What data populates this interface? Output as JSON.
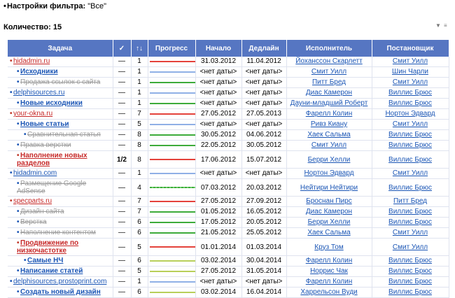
{
  "filter": {
    "label": "Настройки фильтра:",
    "value": "\"Все\""
  },
  "count": {
    "text": "Количество: 15"
  },
  "columns": [
    "Задача",
    "✓",
    "↑↓",
    "Прогресс",
    "Начало",
    "Дедлайн",
    "Исполнитель",
    "Постановщик"
  ],
  "colors": {
    "header": "#5676c2",
    "link": "#1a55b5",
    "accent_red": "#c62828"
  },
  "rows": [
    {
      "indent": 0,
      "task": "hidadmin.ru",
      "style": "red",
      "bullet": "red",
      "done": "—",
      "prio": "1",
      "progress": "red",
      "start": "31.03.2012",
      "deadline": "11.04.2012",
      "assignee": "Йоханссон Скарлетт",
      "author": "Смит Уилл"
    },
    {
      "indent": 1,
      "task": "Исходники",
      "style": "blue-bold",
      "bullet": "blue",
      "done": "—",
      "prio": "1",
      "progress": "blue",
      "start": "<нет даты>",
      "deadline": "<нет даты>",
      "assignee": "Смит Уилл",
      "author": "Шин Чарли"
    },
    {
      "indent": 1,
      "task": "Продажа ссылок с сайта",
      "style": "strike",
      "bullet": "blue",
      "done": "—",
      "prio": "1",
      "progress": "green",
      "start": "<нет даты>",
      "deadline": "<нет даты>",
      "assignee": "Питт Бред",
      "author": "Смит Уилл"
    },
    {
      "indent": 0,
      "task": "delphisources.ru",
      "style": "blue",
      "bullet": "blue",
      "done": "—",
      "prio": "1",
      "progress": "blue",
      "start": "<нет даты>",
      "deadline": "<нет даты>",
      "assignee": "Диас Камерон",
      "author": "Виллис Брюс"
    },
    {
      "indent": 1,
      "task": "Новые исходники",
      "style": "blue-bold",
      "bullet": "blue",
      "done": "—",
      "prio": "1",
      "progress": "green",
      "start": "<нет даты>",
      "deadline": "<нет даты>",
      "assignee": "Дауни-младший Роберт",
      "author": "Виллис Брюс"
    },
    {
      "indent": 0,
      "task": "your-okna.ru",
      "style": "red",
      "bullet": "red",
      "done": "—",
      "prio": "7",
      "progress": "red",
      "start": "27.05.2012",
      "deadline": "27.05.2013",
      "assignee": "Фарелл Колин",
      "author": "Нортон Эдвард"
    },
    {
      "indent": 1,
      "task": "Новые статьи",
      "style": "blue-bold",
      "bullet": "blue",
      "done": "—",
      "prio": "5",
      "progress": "blue",
      "start": "<нет даты>",
      "deadline": "<нет даты>",
      "assignee": "Ривз Киану",
      "author": "Смит Уилл"
    },
    {
      "indent": 2,
      "task": "Сравнительная статья",
      "style": "strike",
      "bullet": "blue",
      "done": "—",
      "prio": "8",
      "progress": "green",
      "start": "30.05.2012",
      "deadline": "04.06.2012",
      "assignee": "Хаек Сальма",
      "author": "Виллис Брюс"
    },
    {
      "indent": 1,
      "task": "Правка верстки",
      "style": "strike",
      "bullet": "blue",
      "done": "—",
      "prio": "8",
      "progress": "green",
      "start": "22.05.2012",
      "deadline": "30.05.2012",
      "assignee": "Смит Уилл",
      "author": "Виллис Брюс"
    },
    {
      "indent": 1,
      "task": "Наполнение новых разделов",
      "style": "red-bold",
      "bullet": "red",
      "done": "1/2",
      "prio": "8",
      "progress": "red",
      "start": "17.06.2012",
      "deadline": "15.07.2012",
      "assignee": "Берри Хелли",
      "author": "Виллис Брюс",
      "tall": true
    },
    {
      "indent": 0,
      "task": "hidadmin.com",
      "style": "blue",
      "bullet": "blue",
      "done": "—",
      "prio": "1",
      "progress": "blue",
      "start": "<нет даты>",
      "deadline": "<нет даты>",
      "assignee": "Нортон Эдвард",
      "author": "Смит Уилл"
    },
    {
      "indent": 1,
      "task": "Размещение Google AdSense",
      "style": "strike",
      "bullet": "blue",
      "done": "—",
      "prio": "4",
      "progress": "greenwave",
      "start": "07.03.2012",
      "deadline": "20.03.2012",
      "assignee": "Нейтири Нейтири",
      "author": "Виллис Брюс",
      "tall": true
    },
    {
      "indent": 0,
      "task": "specparts.ru",
      "style": "red",
      "bullet": "red",
      "done": "—",
      "prio": "7",
      "progress": "red",
      "start": "27.05.2012",
      "deadline": "27.09.2012",
      "assignee": "Броснан Пирс",
      "author": "Питт Бред"
    },
    {
      "indent": 1,
      "task": "Дизайн сайта",
      "style": "strike",
      "bullet": "blue",
      "done": "—",
      "prio": "7",
      "progress": "green",
      "start": "01.05.2012",
      "deadline": "16.05.2012",
      "assignee": "Диас Камерон",
      "author": "Виллис Брюс"
    },
    {
      "indent": 1,
      "task": "Верстка",
      "style": "strike",
      "bullet": "blue",
      "done": "—",
      "prio": "6",
      "progress": "green",
      "start": "17.05.2012",
      "deadline": "20.05.2012",
      "assignee": "Берри Хелли",
      "author": "Виллис Брюс"
    },
    {
      "indent": 1,
      "task": "Наполнение контентом",
      "style": "strike",
      "bullet": "blue",
      "done": "—",
      "prio": "6",
      "progress": "green",
      "start": "21.05.2012",
      "deadline": "25.05.2012",
      "assignee": "Хаек Сальма",
      "author": "Смит Уилл"
    },
    {
      "indent": 1,
      "task": "Продвижение по низкочастотке",
      "style": "red-bold",
      "bullet": "red",
      "done": "—",
      "prio": "5",
      "progress": "red",
      "start": "01.01.2014",
      "deadline": "01.03.2014",
      "assignee": "Круз Том",
      "author": "Смит Уилл",
      "tall": true
    },
    {
      "indent": 2,
      "task": "Самые НЧ",
      "style": "blue-bold",
      "bullet": "blue",
      "done": "—",
      "prio": "6",
      "progress": "olive",
      "start": "03.02.2014",
      "deadline": "30.04.2014",
      "assignee": "Фарелл Колин",
      "author": "Виллис Брюс"
    },
    {
      "indent": 1,
      "task": "Написание статей",
      "style": "blue-bold",
      "bullet": "blue",
      "done": "—",
      "prio": "5",
      "progress": "olive",
      "start": "27.05.2012",
      "deadline": "31.05.2014",
      "assignee": "Норрис Чак",
      "author": "Виллис Брюс"
    },
    {
      "indent": 0,
      "task": "delphisources.prostoprint.com",
      "style": "blue",
      "bullet": "blue",
      "done": "—",
      "prio": "1",
      "progress": "blue",
      "start": "<нет даты>",
      "deadline": "<нет даты>",
      "assignee": "Фарелл Колин",
      "author": "Виллис Брюс"
    },
    {
      "indent": 1,
      "task": "Создать новый дизайн",
      "style": "blue-bold",
      "bullet": "blue",
      "done": "—",
      "prio": "6",
      "progress": "olive",
      "start": "03.02.2014",
      "deadline": "16.04.2014",
      "assignee": "Харрельсон Вуди",
      "author": "Виллис Брюс"
    }
  ]
}
